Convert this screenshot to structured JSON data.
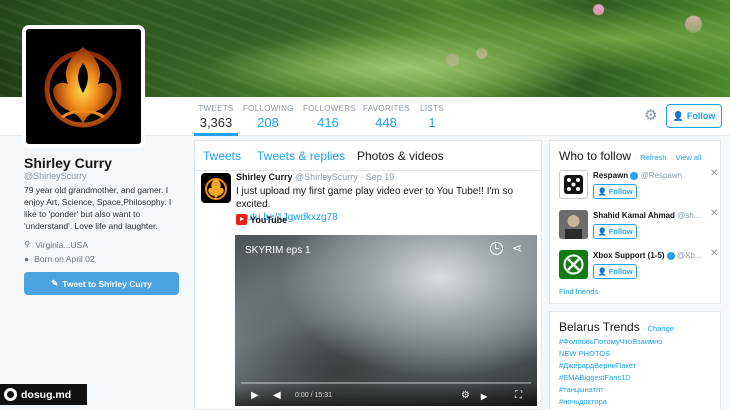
{
  "profile": {
    "name": "Shirley Curry",
    "handle": "@ShirleyScurry",
    "bio": "79 year old grandmother, and gamer. I enjoy Art, Science, Space,Philosophy. I like to 'ponder' but also want to 'understand'. Love life and laughter.",
    "location": "Virginia...USA",
    "birthday": "Born on April 02",
    "tweet_to_label": "Tweet to Shirley Curry"
  },
  "stats": [
    {
      "label": "TWEETS",
      "value": "3,363"
    },
    {
      "label": "FOLLOWING",
      "value": "208"
    },
    {
      "label": "FOLLOWERS",
      "value": "416"
    },
    {
      "label": "FAVORITES",
      "value": "448"
    },
    {
      "label": "LISTS",
      "value": "1"
    }
  ],
  "header": {
    "follow_label": "Follow"
  },
  "timeline": {
    "tabs": [
      "Tweets",
      "Tweets & replies",
      "Photos & videos"
    ],
    "active_tab": "Photos & videos",
    "tweet": {
      "author": "Shirley Curry",
      "handle": "@ShirleyScurry",
      "date": "· Sep 19",
      "text": "I just upload my first game play video ever to You Tube!! I'm so excited.",
      "link": "youtu.be/1Jgwdkxzg78",
      "card_source": "YouTube",
      "video_title": "SKYRIM eps 1",
      "video_time": "0:00 / 15:31"
    }
  },
  "who_to_follow": {
    "title": "Who to follow",
    "refresh": "Refresh",
    "view_all": "View all",
    "separator": "·",
    "follow_label": "Follow",
    "find_friends": "Find friends",
    "accounts": [
      {
        "name": "Respawn",
        "handle": "@Respawn",
        "verified": true
      },
      {
        "name": "Shahid Kamal Ahmad",
        "handle": "@sh...",
        "verified": false
      },
      {
        "name": "Xbox Support (1-5)",
        "handle": "@Xb...",
        "verified": true
      }
    ]
  },
  "trends": {
    "title": "Belarus Trends",
    "change": "· Change",
    "items": [
      "#ФолловьПотомуЧтоВзаимно",
      "NEW PHOTOS",
      "#ДжерардВерниПакет",
      "#EMABiggestFans1D",
      "#танцынатнт",
      "#ночьдоктора"
    ]
  },
  "watermark": "dosug.md"
}
